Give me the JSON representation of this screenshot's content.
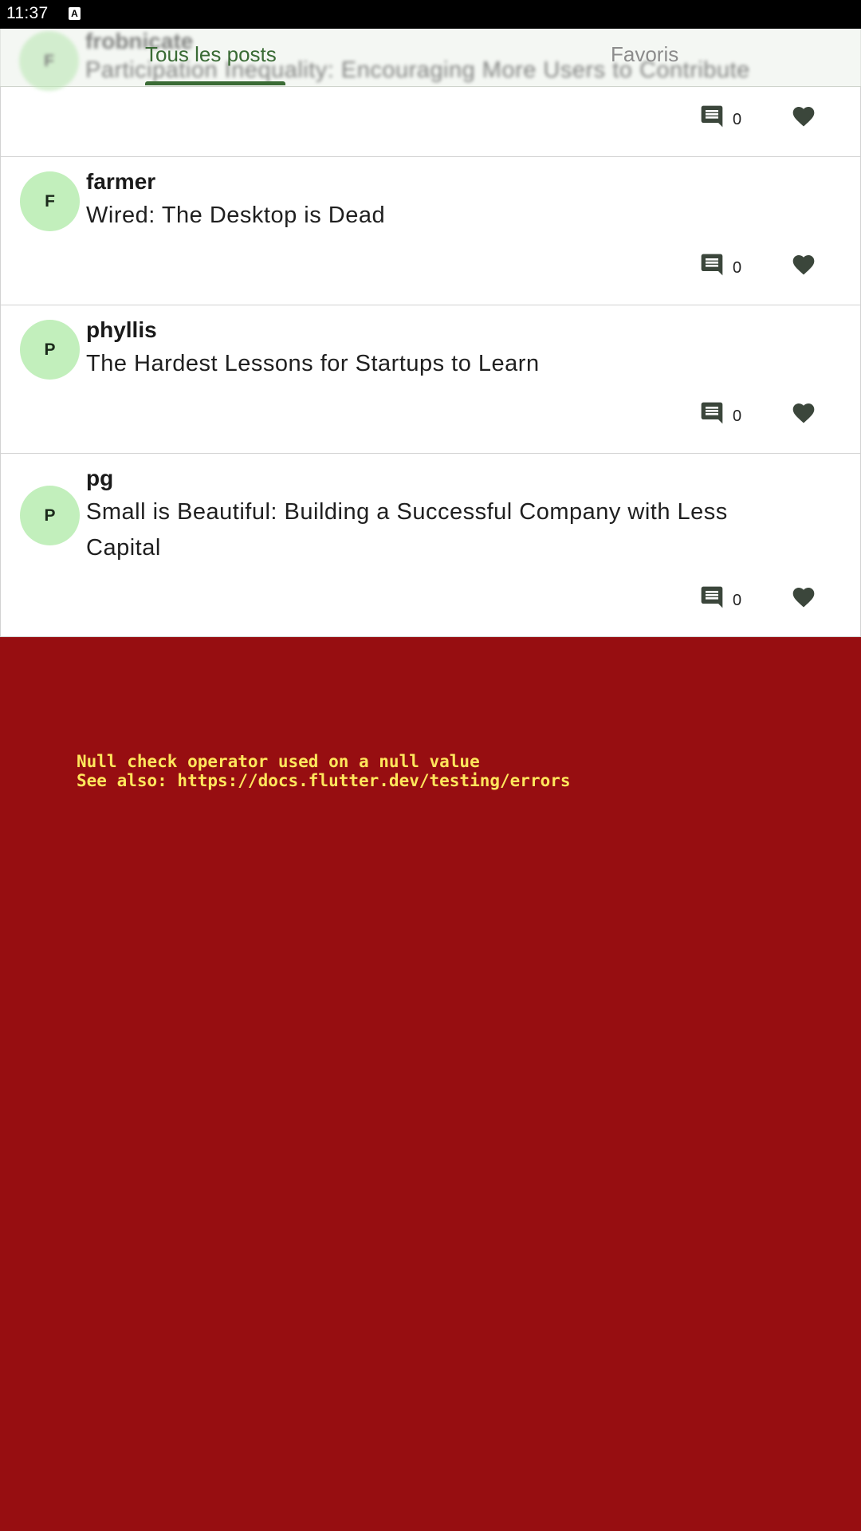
{
  "status_bar": {
    "time": "11:37",
    "notification_icon": "a-icon"
  },
  "tabs": [
    {
      "label": "Tous les posts",
      "selected": true
    },
    {
      "label": "Favoris",
      "selected": false
    }
  ],
  "partial_post": {
    "avatar_letter": "F",
    "author": "frobnicate",
    "title": "Participation Inequality: Encouraging More Users to Contribute",
    "comment_count": "0"
  },
  "posts": [
    {
      "avatar_letter": "F",
      "author": "farmer",
      "title": "Wired: The Desktop is Dead",
      "comment_count": "0"
    },
    {
      "avatar_letter": "P",
      "author": "phyllis",
      "title": "The Hardest Lessons for Startups to Learn",
      "comment_count": "0"
    },
    {
      "avatar_letter": "P",
      "author": "pg",
      "title": "Small is Beautiful: Building a Successful Company with Less Capital",
      "comment_count": "0"
    }
  ],
  "error": {
    "message": "Null check operator used on a null value",
    "see_also": "See also: https://docs.flutter.dev/testing/errors"
  },
  "colors": {
    "tab_selected": "#3a6b35",
    "avatar_bg": "#c2efbc",
    "icon": "#3b463b",
    "error_bg": "#970e11",
    "error_text": "#ffe65c"
  }
}
